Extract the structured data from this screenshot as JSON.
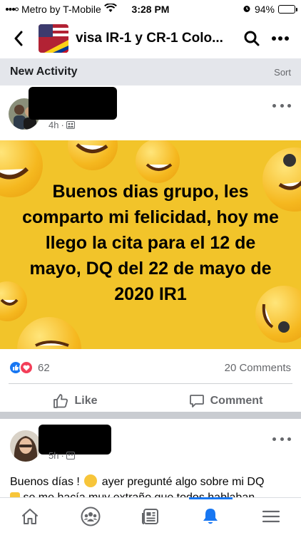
{
  "status_bar": {
    "carrier": "Metro by T-Mobile",
    "time": "3:28 PM",
    "battery_text": "94%",
    "battery_level": 0.94
  },
  "header": {
    "group_name": "visa IR-1 y CR-1 Colo..."
  },
  "activity_bar": {
    "title": "New Activity",
    "sort_label": "Sort"
  },
  "posts": [
    {
      "time": "4h",
      "image_text": "Buenos dias grupo, les comparto mi felicidad, hoy me llego la cita para el 12 de mayo, DQ del 22 de mayo de 2020 IR1",
      "reaction_count": "62",
      "comment_count": "20 Comments",
      "like_label": "Like",
      "comment_label": "Comment"
    },
    {
      "time": "5h",
      "text_before_emoji": "Buenos días !",
      "text_after_emoji": "ayer pregunté algo sobre mi DQ",
      "text_line2": "se me hacía muy extraño que todos hablaban"
    }
  ],
  "colors": {
    "accent": "#1877f2",
    "love": "#f33e58",
    "image_bg": "#f2c42a"
  },
  "bottom_tabs": [
    "home-icon",
    "groups-icon",
    "news-icon",
    "notifications-icon",
    "menu-icon"
  ],
  "active_tab": "notifications-icon"
}
